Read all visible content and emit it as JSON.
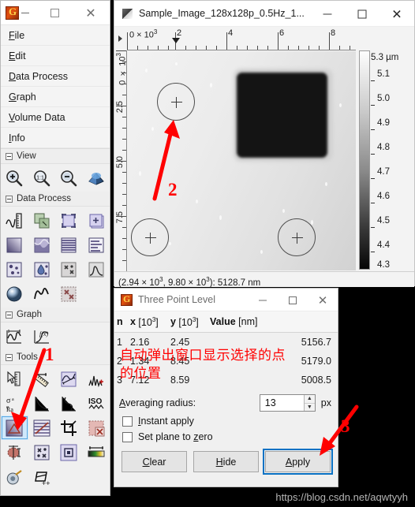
{
  "toolbox": {
    "window_icon": "gwyddion-logo-icon",
    "controls": {
      "minimize": "minimize-icon",
      "maximize": "maximize-icon",
      "close": "close-icon"
    },
    "menu": [
      {
        "label": "File",
        "mnemonic": "F"
      },
      {
        "label": "Edit",
        "mnemonic": "E"
      },
      {
        "label": "Data Process",
        "mnemonic": "D"
      },
      {
        "label": "Graph",
        "mnemonic": "G"
      },
      {
        "label": "Volume Data",
        "mnemonic": "V"
      },
      {
        "label": "Info",
        "mnemonic": "I"
      }
    ],
    "sections": [
      {
        "title": "View",
        "tools": [
          {
            "name": "zoom-in-icon"
          },
          {
            "name": "zoom-1-1-icon"
          },
          {
            "name": "zoom-out-icon"
          },
          {
            "name": "3d-view-icon"
          }
        ]
      },
      {
        "title": "Data Process",
        "tools": [
          {
            "name": "scale-ruler-icon"
          },
          {
            "name": "merge-layers-icon"
          },
          {
            "name": "crop-area-icon"
          },
          {
            "name": "arithmetic-icon"
          },
          {
            "name": "level-plane-icon"
          },
          {
            "name": "rough-surface-icon"
          },
          {
            "name": "line-correct-icon"
          },
          {
            "name": "align-rows-icon"
          },
          {
            "name": "grain-mark-icon"
          },
          {
            "name": "drop-grains-icon"
          },
          {
            "name": "remove-spots-icon"
          },
          {
            "name": "statistics-curve-icon"
          },
          {
            "name": "sphere-shade-icon"
          },
          {
            "name": "wave-filter-icon"
          },
          {
            "name": "mask-remove-icon"
          }
        ]
      },
      {
        "title": "Graph",
        "tools": [
          {
            "name": "graph-profile-icon"
          },
          {
            "name": "graph-function-icon"
          }
        ]
      },
      {
        "title": "Tools",
        "tools": [
          {
            "name": "read-value-icon"
          },
          {
            "name": "measure-distance-icon"
          },
          {
            "name": "profile-extract-icon",
            "highlight": false
          },
          {
            "name": "spectrum-peaks-icon"
          },
          {
            "name": "roughness-sigma-icon"
          },
          {
            "name": "distribution-curve-icon"
          },
          {
            "name": "bearing-ratio-icon"
          },
          {
            "name": "iso-roughness-icon"
          },
          {
            "name": "three-point-level-icon",
            "selected": true
          },
          {
            "name": "facet-level-icon"
          },
          {
            "name": "crop-tool-icon"
          },
          {
            "name": "mask-edit-icon"
          },
          {
            "name": "grain-measure-icon"
          },
          {
            "name": "remove-spots-tool-icon"
          },
          {
            "name": "select-area-icon"
          },
          {
            "name": "color-range-icon"
          },
          {
            "name": "filter-tool-icon"
          },
          {
            "name": "path-level-icon"
          }
        ]
      }
    ]
  },
  "image_window": {
    "title": "Sample_Image_128x128p_0.5Hz_1...",
    "controls": {
      "minimize": "minimize-icon",
      "maximize": "maximize-icon",
      "close": "close-icon"
    },
    "top_ruler": {
      "unit_label": "0 × 10",
      "unit_exponent": "3",
      "ticks": [
        "2",
        "4",
        "6",
        "8"
      ],
      "cursor_marker": "ruler-position-marker"
    },
    "left_ruler": {
      "unit_label": "0 × 10",
      "unit_exponent": "3",
      "ticks": [
        "2.5",
        "5.0",
        "7.5"
      ]
    },
    "color_bar": {
      "unit": "5.3 µm",
      "ticks": [
        "5.1",
        "5.0",
        "4.9",
        "4.8",
        "4.7",
        "4.6",
        "4.5",
        "4.4",
        "4.3"
      ]
    },
    "markers": [
      {
        "name": "level-point-marker-1"
      },
      {
        "name": "level-point-marker-2"
      },
      {
        "name": "level-point-marker-3"
      }
    ],
    "status_prefix": "(2.94 × 10",
    "status_exp1": "3",
    "status_mid": ", 9.80 × 10",
    "status_exp2": "3",
    "status_suffix": "): 5128.7 nm"
  },
  "three_point_level": {
    "title": "Three Point Level",
    "window_icon": "gwyddion-logo-icon",
    "controls": {
      "minimize": "minimize-icon",
      "maximize": "maximize-icon",
      "close": "close-icon"
    },
    "table": {
      "headers": {
        "n": "n",
        "x": "x",
        "x_unit": " [10",
        "x_exp": "3",
        "x_unit_end": "]",
        "y": "y",
        "y_unit": " [10",
        "y_exp": "3",
        "y_unit_end": "]",
        "value": "Value",
        "value_unit": " [nm]"
      },
      "rows": [
        {
          "n": "1",
          "x": "2.16",
          "y": "2.45",
          "value": "5156.7"
        },
        {
          "n": "2",
          "x": "1.34",
          "y": "8.45",
          "value": "5179.0"
        },
        {
          "n": "3",
          "x": "7.12",
          "y": "8.59",
          "value": "5008.5"
        }
      ]
    },
    "averaging_radius": {
      "label": "Averaging radius:",
      "label_mnemonic": "A",
      "value": "13",
      "unit": "px",
      "spinner_up": "spinner-up-icon",
      "spinner_down": "spinner-down-icon"
    },
    "checkboxes": [
      {
        "label": "Instant apply",
        "mnemonic": "I",
        "checked": false
      },
      {
        "label": "Set plane to zero",
        "mnemonic": "z",
        "checked": false
      }
    ],
    "buttons": [
      {
        "label": "Clear",
        "mnemonic": "C",
        "focused": false
      },
      {
        "label": "Hide",
        "mnemonic": "H",
        "focused": false
      },
      {
        "label": "Apply",
        "mnemonic": "A",
        "focused": true
      }
    ]
  },
  "annotations": {
    "marker_1": "1",
    "marker_2": "2",
    "marker_3": "3",
    "chinese_note_line1": "自动弹出窗口显示选择的点",
    "chinese_note_line2": "的位置",
    "arrow_color": "#ff0000"
  },
  "watermark": "https://blog.csdn.net/aqwtyyh"
}
